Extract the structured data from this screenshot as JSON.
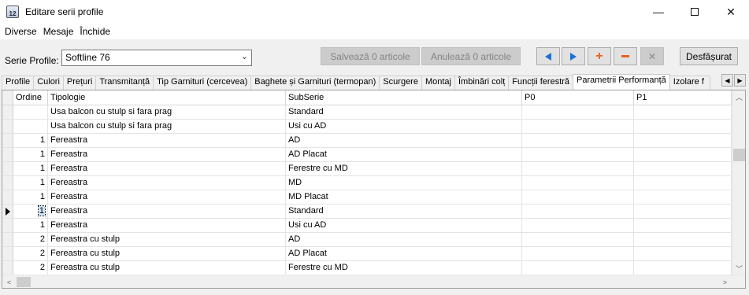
{
  "window": {
    "title": "Editare serii profile",
    "icon_text": "12"
  },
  "menu": [
    {
      "label": "Diverse"
    },
    {
      "label": "Mesaje"
    },
    {
      "label": "Închide"
    }
  ],
  "toolbar": {
    "serie_label": "Serie Profile:",
    "serie_value": "Softline 76",
    "save_label": "Salvează 0 articole",
    "cancel_label": "Anulează 0 articole",
    "expand_label": "Desfășurat"
  },
  "tabs": [
    {
      "label": "Profile"
    },
    {
      "label": "Culori"
    },
    {
      "label": "Prețuri"
    },
    {
      "label": "Transmitanță"
    },
    {
      "label": "Tip Garnituri (cercevea)"
    },
    {
      "label": "Baghete și Garnituri (termopan)"
    },
    {
      "label": "Scurgere"
    },
    {
      "label": "Montaj"
    },
    {
      "label": "Îmbinări colț"
    },
    {
      "label": "Funcții ferestră"
    },
    {
      "label": "Parametrii Performanță"
    },
    {
      "label": "Izolare f"
    }
  ],
  "active_tab": "Parametrii Performanță",
  "grid": {
    "columns": [
      "Ordine",
      "Tipologie",
      "SubSerie",
      "P0",
      "P1"
    ],
    "rows": [
      {
        "ordine": "",
        "tipologie": "Usa balcon cu stulp si fara prag",
        "subserie": "Standard",
        "p0": "",
        "p1": ""
      },
      {
        "ordine": "",
        "tipologie": "Usa balcon cu stulp si fara prag",
        "subserie": "Usi cu AD",
        "p0": "",
        "p1": ""
      },
      {
        "ordine": "1",
        "tipologie": "Fereastra",
        "subserie": "AD",
        "p0": "",
        "p1": ""
      },
      {
        "ordine": "1",
        "tipologie": "Fereastra",
        "subserie": "AD Placat",
        "p0": "",
        "p1": ""
      },
      {
        "ordine": "1",
        "tipologie": "Fereastra",
        "subserie": "Ferestre cu MD",
        "p0": "",
        "p1": ""
      },
      {
        "ordine": "1",
        "tipologie": "Fereastra",
        "subserie": "MD",
        "p0": "",
        "p1": ""
      },
      {
        "ordine": "1",
        "tipologie": "Fereastra",
        "subserie": "MD Placat",
        "p0": "",
        "p1": ""
      },
      {
        "ordine": "1",
        "tipologie": "Fereastra",
        "subserie": "Standard",
        "p0": "",
        "p1": ""
      },
      {
        "ordine": "1",
        "tipologie": "Fereastra",
        "subserie": "Usi cu AD",
        "p0": "",
        "p1": ""
      },
      {
        "ordine": "2",
        "tipologie": "Fereastra cu stulp",
        "subserie": "AD",
        "p0": "",
        "p1": ""
      },
      {
        "ordine": "2",
        "tipologie": "Fereastra cu stulp",
        "subserie": "AD Placat",
        "p0": "",
        "p1": ""
      },
      {
        "ordine": "2",
        "tipologie": "Fereastra cu stulp",
        "subserie": "Ferestre cu MD",
        "p0": "",
        "p1": ""
      }
    ],
    "current_row_index": 7
  },
  "colors": {
    "arrow_blue": "#1e6fd9",
    "accent_orange": "#e8631a",
    "selection": "#cce4f7"
  }
}
